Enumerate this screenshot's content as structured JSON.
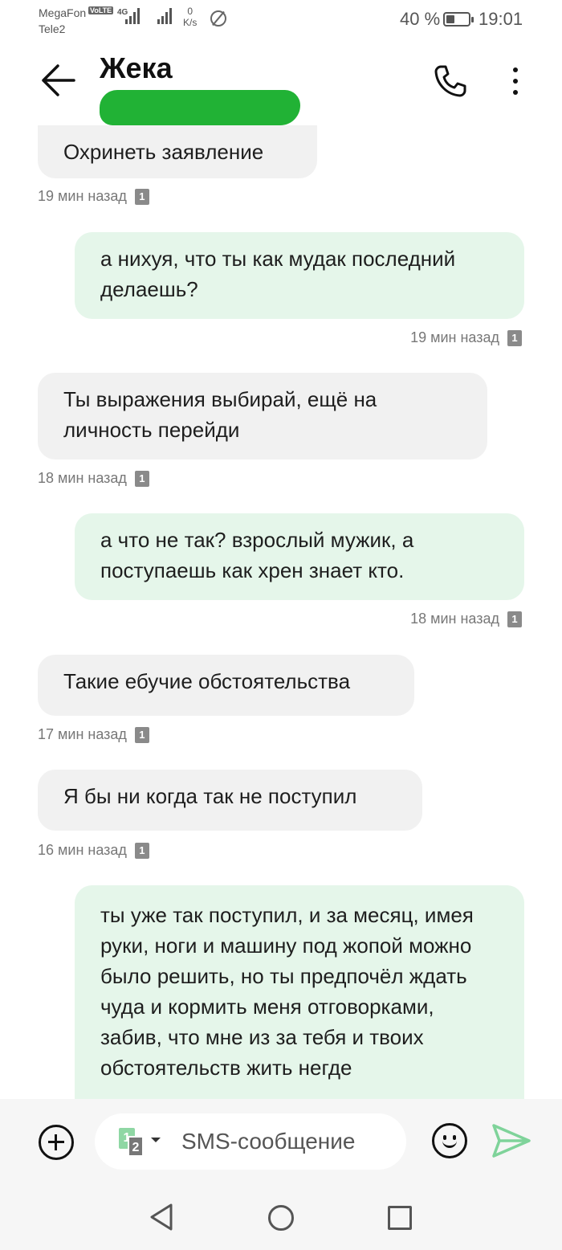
{
  "status_bar": {
    "carrier_1": "MegaFon",
    "carrier_2": "Tele2",
    "volte": "VoLTE",
    "network": "4G",
    "speed_value": "0",
    "speed_unit": "K/s",
    "battery_percent": "40 %",
    "battery_level": 0.4,
    "time": "19:01"
  },
  "header": {
    "contact_name": "Жека",
    "back_icon": "arrow-left-icon",
    "call_icon": "phone-icon",
    "menu_icon": "more-vertical-icon"
  },
  "messages": [
    {
      "direction": "incoming",
      "text": "Охринеть заявление",
      "time": "19 мин назад",
      "sim": "1"
    },
    {
      "direction": "outgoing",
      "text": "а нихуя, что ты как мудак последний делаешь?",
      "time": "19 мин назад",
      "sim": "1"
    },
    {
      "direction": "incoming",
      "text": "Ты выражения выбирай, ещё на личность перейди",
      "time": "18 мин назад",
      "sim": "1"
    },
    {
      "direction": "outgoing",
      "text": "а что не так? взрослый мужик, а поступаешь как хрен знает кто.",
      "time": "18 мин назад",
      "sim": "1"
    },
    {
      "direction": "incoming",
      "text": "Такие ебучие обстоятельства",
      "time": "17 мин назад",
      "sim": "1"
    },
    {
      "direction": "incoming",
      "text": "Я бы ни когда так не поступил",
      "time": "16 мин назад",
      "sim": "1"
    },
    {
      "direction": "outgoing",
      "text": "ты уже так поступил, и за месяц, имея руки, ноги и машину под жопой можно было решить, но ты предпочёл ждать чуда и кормить меня отговорками, забив, что мне из за тебя и твоих обстоятельств жить негде",
      "time": "",
      "sim": ""
    }
  ],
  "composer": {
    "sim_1": "1",
    "sim_2": "2",
    "placeholder": "SMS-сообщение"
  },
  "colors": {
    "incoming_bubble": "#f1f1f1",
    "outgoing_bubble": "#e5f6ea",
    "send_accent": "#7fd39a",
    "redaction": "#21b235"
  }
}
